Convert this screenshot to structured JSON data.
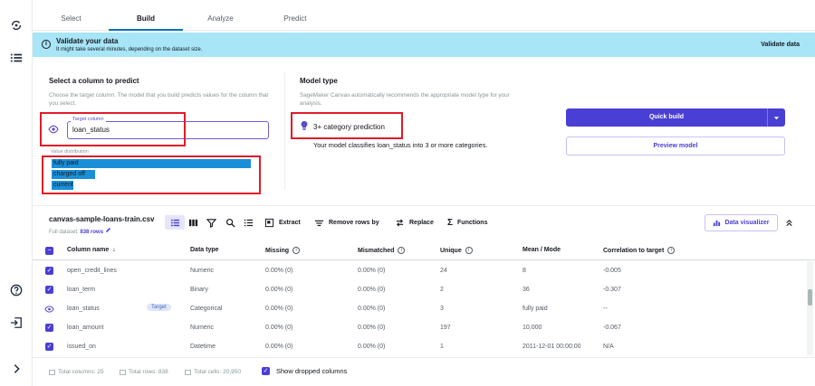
{
  "tabs": [
    {
      "label": "Select"
    },
    {
      "label": "Build"
    },
    {
      "label": "Analyze"
    },
    {
      "label": "Predict"
    }
  ],
  "banner": {
    "title": "Validate your data",
    "subtitle": "It might take several minutes, depending on the dataset size.",
    "action": "Validate data"
  },
  "target_panel": {
    "title": "Select a column to predict",
    "description": "Choose the target column. The model that you build predicts values for the column that you select.",
    "field_label": "Target column",
    "field_value": "loan_status",
    "distribution_label": "Value distribution",
    "distribution": [
      {
        "label": "fully paid",
        "fraction": 1.0
      },
      {
        "label": "charged off",
        "fraction": 0.22
      },
      {
        "label": "current",
        "fraction": 0.11
      }
    ]
  },
  "model_panel": {
    "title": "Model type",
    "description": "SageMaker Canvas automatically recommends the appropriate model type for your analysis.",
    "value": "3+ category prediction",
    "explanation": "Your model classifies loan_status into 3 or more categories."
  },
  "actions": {
    "quick_build": "Quick build",
    "preview": "Preview model"
  },
  "dataset": {
    "name": "canvas-sample-loans-train.csv",
    "full_label": "Full dataset:",
    "rows": "838 rows",
    "tools": {
      "extract": "Extract",
      "remove_rows": "Remove rows by",
      "replace": "Replace",
      "functions": "Functions"
    },
    "visualizer": "Data visualizer"
  },
  "table": {
    "headers": {
      "name": "Column name",
      "type": "Data type",
      "missing": "Missing",
      "mismatched": "Mismatched",
      "unique": "Unique",
      "mean": "Mean / Mode",
      "corr": "Correlation to target"
    },
    "target_badge": "Target",
    "rows": [
      {
        "name": "open_credit_lines",
        "type": "Numeric",
        "missing": "0.00% (0)",
        "mismatched": "0.00% (0)",
        "unique": "24",
        "mean": "8",
        "corr": "-0.005"
      },
      {
        "name": "loan_term",
        "type": "Binary",
        "missing": "0.00% (0)",
        "mismatched": "0.00% (0)",
        "unique": "2",
        "mean": "36",
        "corr": "-0.307"
      },
      {
        "name": "loan_status",
        "type": "Categorical",
        "missing": "0.00% (0)",
        "mismatched": "0.00% (0)",
        "unique": "3",
        "mean": "fully paid",
        "corr": "--"
      },
      {
        "name": "loan_amount",
        "type": "Numeric",
        "missing": "0.00% (0)",
        "mismatched": "0.00% (0)",
        "unique": "197",
        "mean": "10,000",
        "corr": "-0.067"
      },
      {
        "name": "issued_on",
        "type": "Datetime",
        "missing": "0.00% (0)",
        "mismatched": "0.00% (0)",
        "unique": "1",
        "mean": "2011-12-01 00:00:00",
        "corr": "N/A"
      }
    ]
  },
  "footer": {
    "total_columns": "Total columns: 25",
    "total_rows": "Total rows: 838",
    "total_cells": "Total cells: 20,950",
    "show_dropped": "Show dropped columns"
  },
  "colors": {
    "accent": "#4a3fd4",
    "banner": "#a7e5f7",
    "highlight": "#e01c28",
    "distribution_bar": "#1a8fd8"
  }
}
